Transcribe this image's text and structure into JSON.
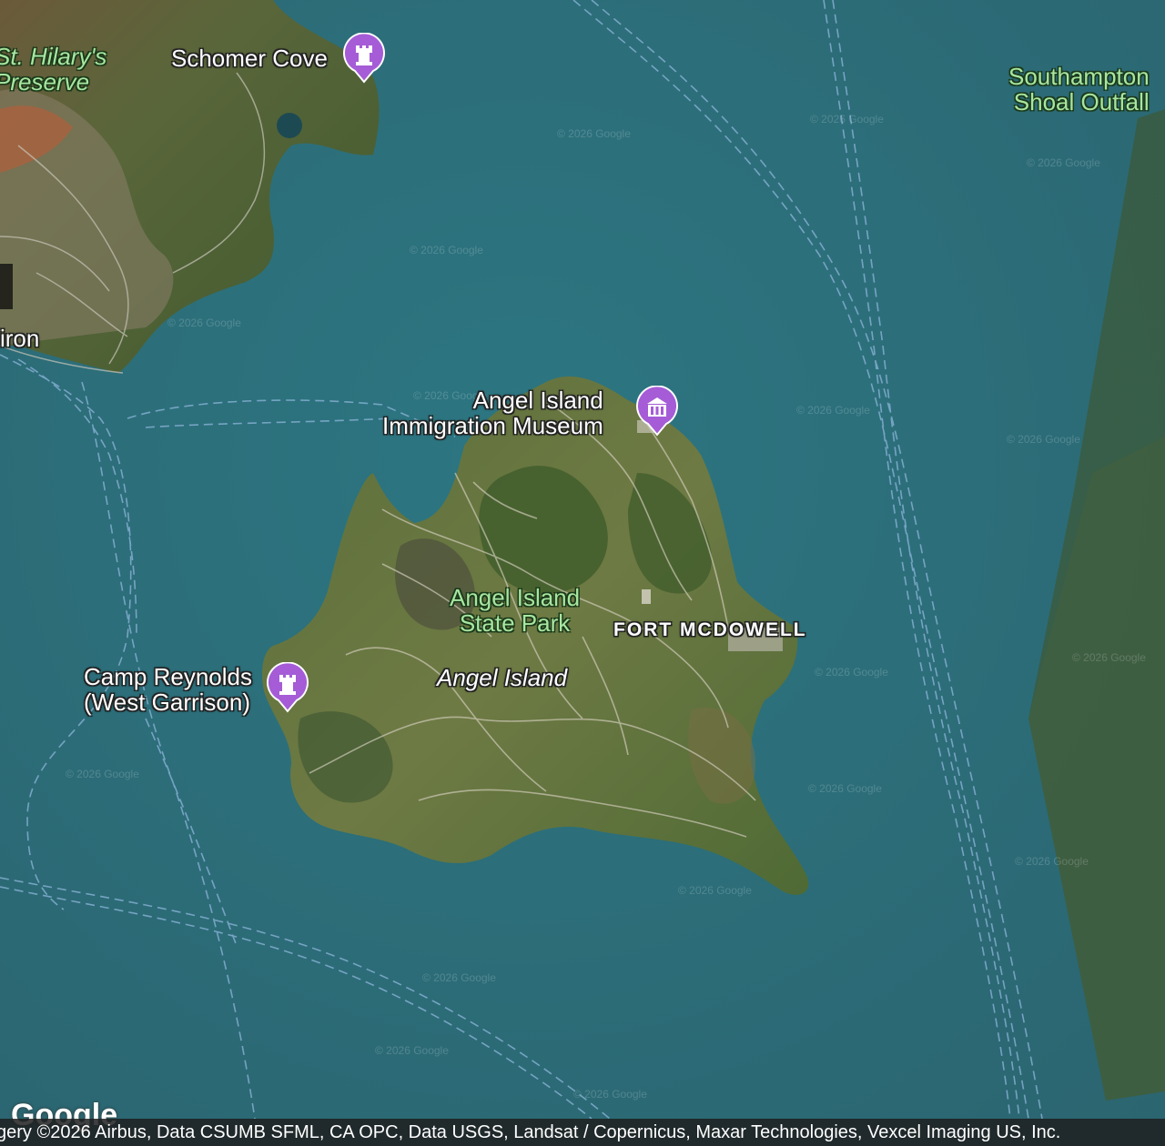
{
  "map": {
    "type": "satellite",
    "labels": {
      "st_hilarys": "St. Hilary's\nPreserve",
      "schomer_cove": "Schomer Cove",
      "southampton": "Southampton\nShoal Outfall",
      "tiburon_fragment": "iron",
      "angel_museum": "Angel Island\nImmigration Museum",
      "angel_state_park": "Angel Island\nState Park",
      "fort_mcdowell": "FORT MCDOWELL",
      "angel_island": "Angel Island",
      "camp_reynolds": "Camp Reynolds\n(West Garrison)"
    },
    "pins": {
      "schomer_cove": "castle-icon",
      "angel_museum": "museum-icon",
      "camp_reynolds": "castle-icon"
    },
    "watermark": "© 2026 Google",
    "logo": "Google",
    "attribution": "gery ©2026 Airbus, Data CSUMB SFML, CA OPC, Data USGS, Landsat / Copernicus, Maxar Technologies, Vexcel Imaging US, Inc.",
    "colors": {
      "water": "#2f6f78",
      "pin": "#a55cd6",
      "park_label": "#a8e6a0"
    }
  }
}
